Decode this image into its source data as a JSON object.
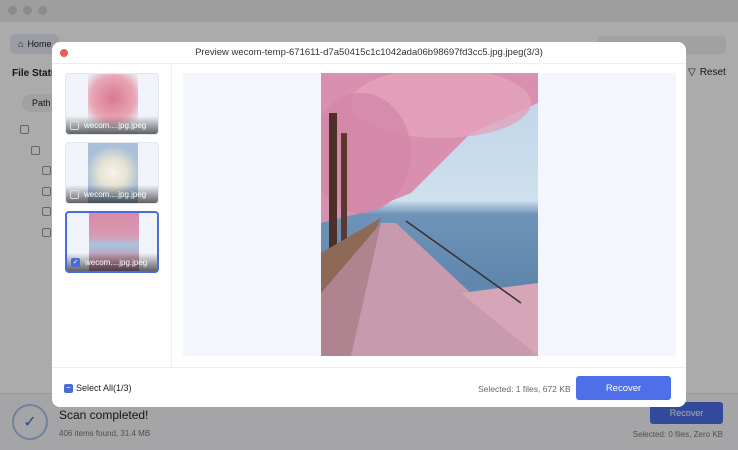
{
  "background": {
    "home_label": "Home",
    "file_status": "File Status",
    "path_tab": "Path",
    "reset_label": "Reset",
    "scan_status": "Scan completed!",
    "items_found": "406 items found, 31.4 MB",
    "recover_label": "Recover",
    "selected": "Selected: 0 files, Zero KB"
  },
  "modal": {
    "title": "Preview wecom-temp-671611-d7a50415c1c1042ada06b98697fd3cc5.jpg.jpeg(3/3)",
    "thumbnails": [
      {
        "name": "wecom....jpg.jpeg",
        "checked": false
      },
      {
        "name": "wecom....jpg.jpeg",
        "checked": false
      },
      {
        "name": "wecom....jpg.jpeg",
        "checked": true
      }
    ],
    "select_all": "Select All(1/3)",
    "selected": "Selected: 1 files, 672 KB",
    "recover_label": "Recover"
  },
  "colors": {
    "accent": "#4d6fe8",
    "close": "#ee5b52"
  }
}
